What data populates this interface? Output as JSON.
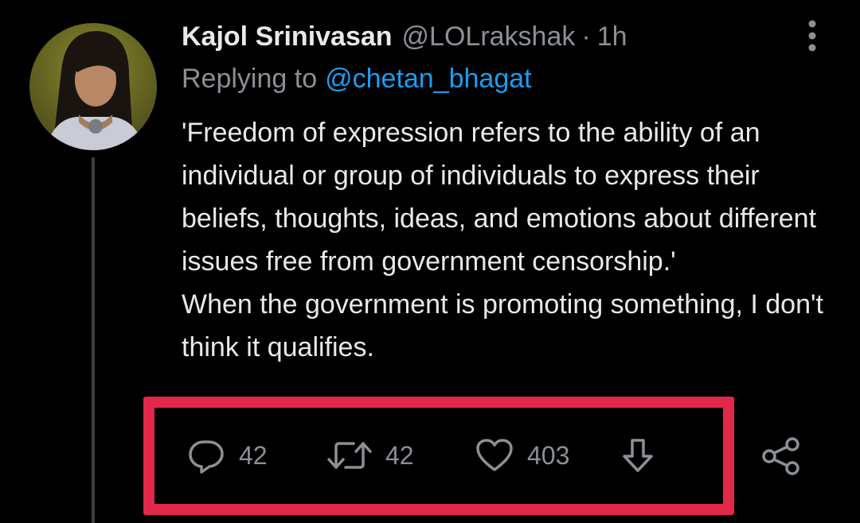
{
  "tweet": {
    "author_name": "Kajol Srinivasan",
    "author_handle": "@LOLrakshak",
    "separator": "·",
    "time": "1h",
    "replying_to_label": "Replying to",
    "replying_to_handle": "@chetan_bhagat",
    "body": "'Freedom of expression refers to the ability of an individual or group of individuals to express their beliefs, thoughts, ideas, and emotions about different issues free from government censorship.'\nWhen the government is promoting something, I don't think it qualifies."
  },
  "actions": {
    "reply_count": "42",
    "retweet_count": "42",
    "like_count": "403"
  },
  "icons": {
    "reply": "reply-icon",
    "retweet": "retweet-icon",
    "like": "heart-icon",
    "download": "arrow-down-icon",
    "share": "share-icon",
    "more": "more-vertical-icon"
  },
  "colors": {
    "background": "#000000",
    "text": "#e7e9ea",
    "muted": "#8b9096",
    "mention": "#1d9bf0",
    "highlight": "#e22849"
  }
}
